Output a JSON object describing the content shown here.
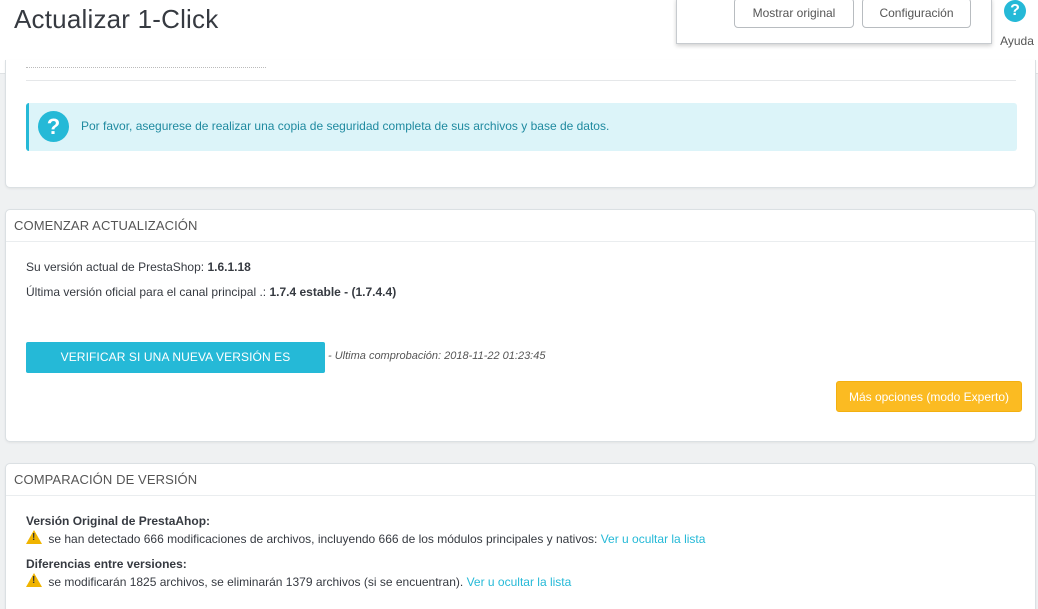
{
  "header": {
    "title": "Actualizar 1-Click",
    "buttons": {
      "show_original": "Mostrar original",
      "configuration": "Configuración"
    },
    "help": {
      "icon": "question-icon",
      "label": "Ayuda"
    }
  },
  "backup_alert": {
    "icon": "question-icon",
    "text": "Por favor, asegurese de realizar una copia de seguridad completa de sus archivos y base de datos."
  },
  "start_update": {
    "heading": "COMENZAR ACTUALIZACIÓN",
    "current_version_label": "Su versión actual de PrestaShop:",
    "current_version_value": "1.6.1.18",
    "latest_version_label": "Última versión oficial para el canal principal .:",
    "latest_version_value": "1.7.4 estable - (1.7.4.4)",
    "check_button": "VERIFICAR SI UNA NUEVA VERSIÓN ES DISPONIBLE",
    "last_check": "- Ultima comprobación: 2018-11-22 01:23:45",
    "expert_button": "Más opciones (modo Experto)"
  },
  "version_comparison": {
    "heading": "COMPARACIÓN DE VERSIÓN",
    "original_label": "Versión Original de PrestaAhop:",
    "original_text": "se han detectado 666 modificaciones de archivos, incluyendo 666 de los módulos principales y nativos:",
    "original_link": "Ver u ocultar la lista",
    "diff_label": "Diferencias entre versiones:",
    "diff_text": "se modificarán 1825 archivos, se eliminarán 1379 archivos (si se encuentran).",
    "diff_link": "Ver u ocultar la lista",
    "warning_icon": "warning-icon"
  },
  "colors": {
    "primary": "#25b9d7",
    "warning": "#fbbb22",
    "alert_bg": "#dcf4f9"
  }
}
